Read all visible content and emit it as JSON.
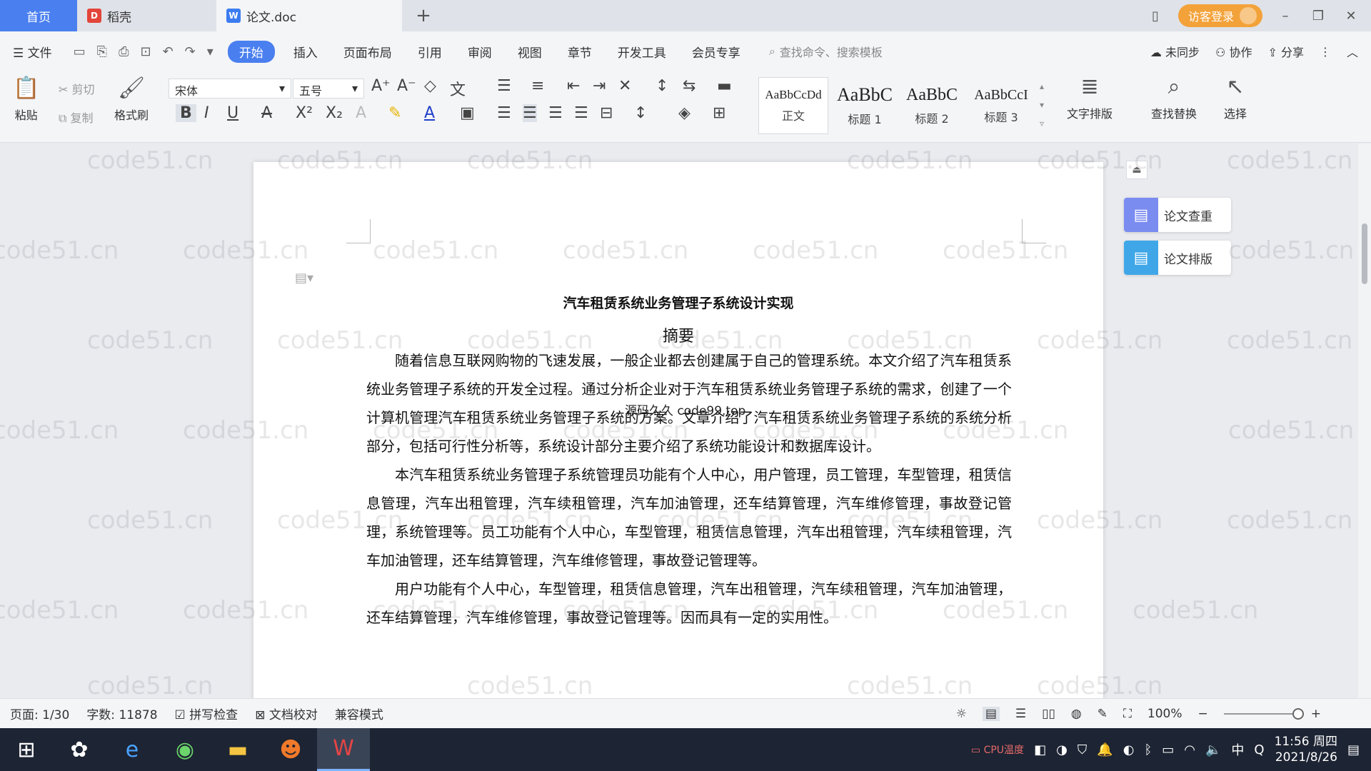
{
  "titlebar": {
    "home_tab": "首页",
    "tabs": [
      {
        "label": "稻壳",
        "icon": "docer-icon"
      },
      {
        "label": "论文.doc",
        "icon": "word-doc-icon"
      }
    ],
    "login_label": "访客登录"
  },
  "menubar": {
    "file_label": "文件",
    "items": [
      "开始",
      "插入",
      "页面布局",
      "引用",
      "审阅",
      "视图",
      "章节",
      "开发工具",
      "会员专享"
    ],
    "search_placeholder": "查找命令、搜索模板",
    "right": [
      "未同步",
      "协作",
      "分享"
    ]
  },
  "ribbon": {
    "paste": "粘贴",
    "cut": "剪切",
    "copy": "复制",
    "format_painter": "格式刷",
    "font_name": "宋体",
    "font_size": "五号",
    "styles": [
      {
        "sample": "AaBbCcDd",
        "name": "正文"
      },
      {
        "sample": "AaBbC",
        "name": "标题 1"
      },
      {
        "sample": "AaBbC",
        "name": "标题 2"
      },
      {
        "sample": "AaBbCcI",
        "name": "标题 3"
      }
    ],
    "text_layout": "文字排版",
    "find_replace": "查找替换",
    "select": "选择"
  },
  "document": {
    "title": "汽车租赁系统业务管理子系统设计实现",
    "abstract_heading": "摘要",
    "paragraphs": [
      "随着信息互联网购物的飞速发展，一般企业都去创建属于自己的管理系统。本文介绍了汽车租赁系统业务管理子系统的开发全过程。通过分析企业对于汽车租赁系统业务管理子系统的需求，创建了一个计算机管理汽车租赁系统业务管理子系统的方案。文章介绍了汽车租赁系统业务管理子系统的系统分析部分，包括可行性分析等，系统设计部分主要介绍了系统功能设计和数据库设计。",
      "本汽车租赁系统业务管理子系统管理员功能有个人中心，用户管理，员工管理，车型管理，租赁信息管理，汽车出租管理，汽车续租管理，汽车加油管理，还车结算管理，汽车维修管理，事故登记管理，系统管理等。员工功能有个人中心，车型管理，租赁信息管理，汽车出租管理，汽车续租管理，汽车加油管理，还车结算管理，汽车维修管理，事故登记管理等。",
      "用户功能有个人中心，车型管理，租赁信息管理，汽车出租管理，汽车续租管理，汽车加油管理，还车结算管理，汽车维修管理，事故登记管理等。因而具有一定的实用性。"
    ],
    "overlay_text": "源码久久 code99.top",
    "watermark": "code51.cn"
  },
  "side_panel": {
    "check": "论文查重",
    "layout": "论文排版"
  },
  "statusbar": {
    "page": "页面: 1/30",
    "words": "字数: 11878",
    "spell": "拼写检查",
    "proof": "文档校对",
    "compat": "兼容模式",
    "zoom": "100%"
  },
  "taskbar": {
    "tray_text": "CPU温度",
    "ime": "中",
    "time": "11:56 周四",
    "date": "2021/8/26"
  },
  "colors": {
    "accent": "#4a7ff0",
    "login": "#f3a23a",
    "taskbar": "#1d2433"
  }
}
